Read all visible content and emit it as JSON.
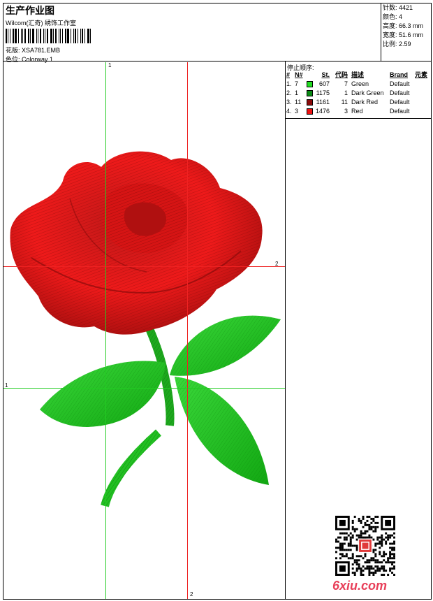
{
  "header": {
    "title": "生产作业图",
    "studio": "Wilcom(汇奇) 绣饰工作室",
    "file_label": "花版:",
    "file_name": "XSA781.EMB",
    "colorway_label": "色位:",
    "colorway": "Colorway 1"
  },
  "stats": [
    {
      "label": "针数:",
      "value": "4421"
    },
    {
      "label": "颜色:",
      "value": "4"
    },
    {
      "label": "高度:",
      "value": "66.3 mm"
    },
    {
      "label": "宽度:",
      "value": "51.6 mm"
    },
    {
      "label": "比例:",
      "value": "2.59"
    }
  ],
  "stop_sequence": {
    "label": "停止顺序:",
    "columns": [
      "#",
      "N#",
      "St.",
      "代码",
      "描述",
      "Brand",
      "元素"
    ],
    "rows": [
      {
        "idx": "1.",
        "n": "7",
        "st": "607",
        "code": "7",
        "desc": "Green",
        "brand": "Default",
        "color": "#22dd22"
      },
      {
        "idx": "2.",
        "n": "1",
        "st": "1175",
        "code": "1",
        "desc": "Dark Green",
        "brand": "Default",
        "color": "#0a8a14"
      },
      {
        "idx": "3.",
        "n": "11",
        "st": "1161",
        "code": "11",
        "desc": "Dark Red",
        "brand": "Default",
        "color": "#8a0a0a"
      },
      {
        "idx": "4.",
        "n": "3",
        "st": "1476",
        "code": "3",
        "desc": "Red",
        "brand": "Default",
        "color": "#ee1111"
      }
    ]
  },
  "canvas": {
    "grid_labels": {
      "top": "1",
      "right": "2",
      "left": "1",
      "bottom": "2"
    },
    "guide_color_green": "#22cc22",
    "guide_color_red": "#ee2222"
  },
  "watermark": {
    "text": "6xiu.com",
    "color": "#e8405a"
  }
}
